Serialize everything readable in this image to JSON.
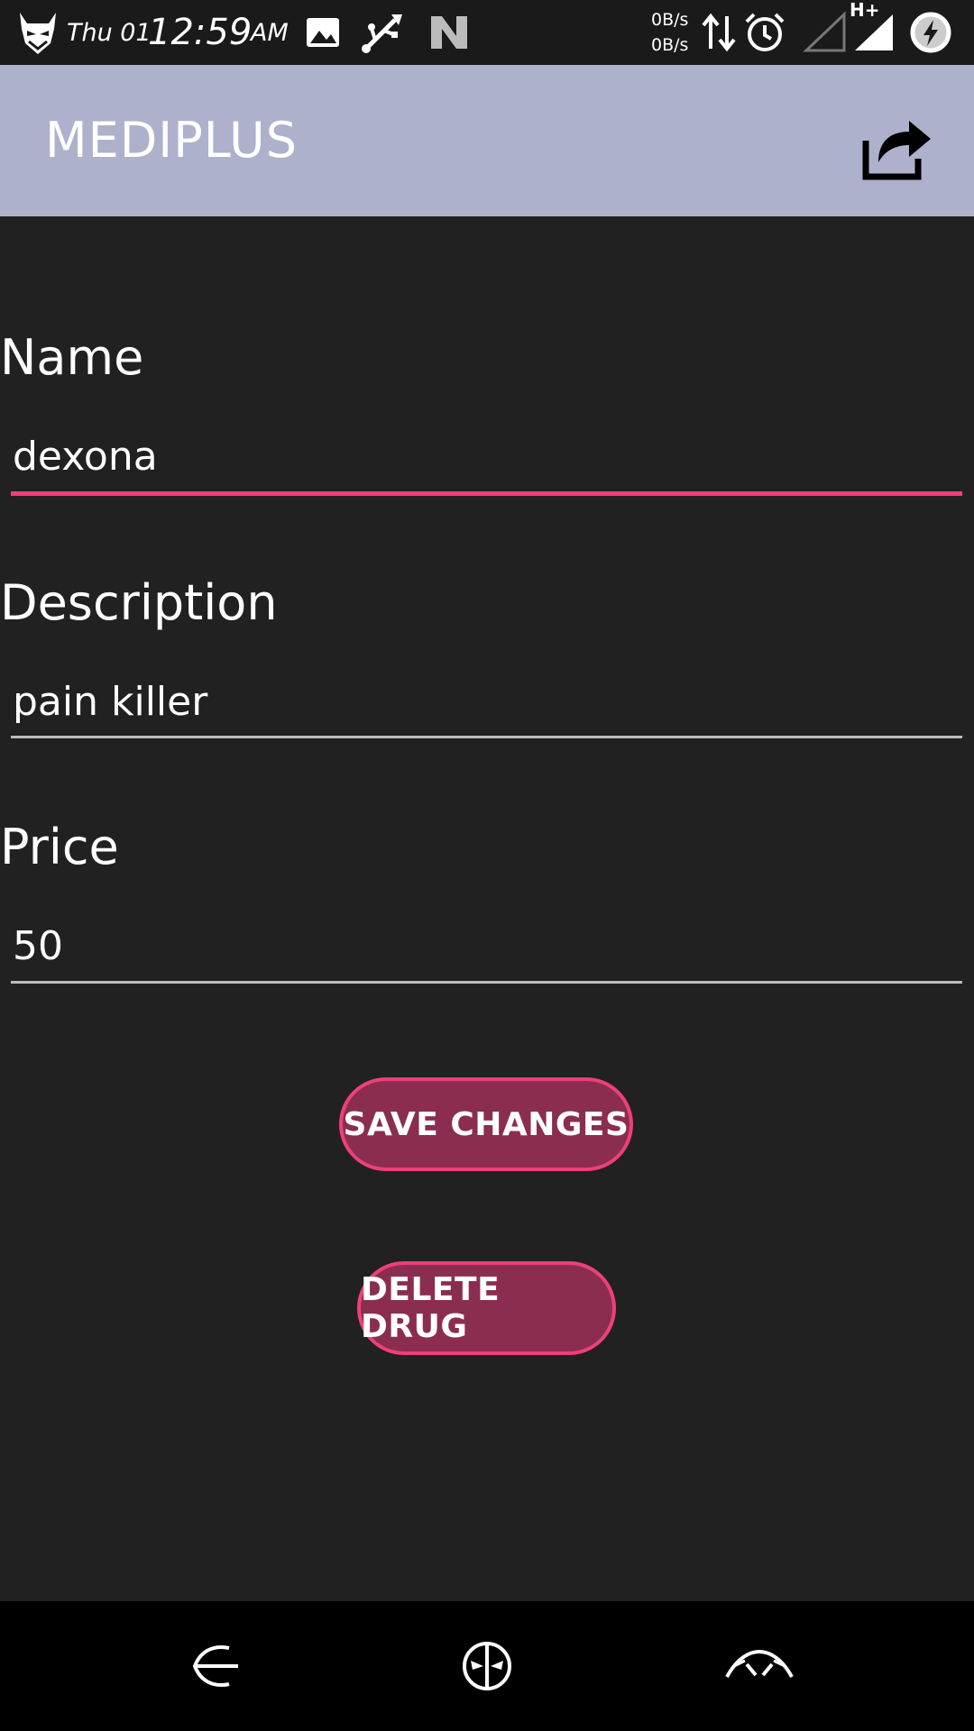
{
  "status_bar": {
    "day": "Thu 01",
    "time": "12:59",
    "ampm": "AM",
    "rate_up": "0B/s",
    "rate_down": "0B/s",
    "network": "H+",
    "icons": [
      "devil-logo-icon",
      "image-icon",
      "usb-icon",
      "n-icon",
      "data-arrows-icon",
      "alarm-icon",
      "signal-empty-icon",
      "signal-full-icon",
      "battery-charging-icon"
    ]
  },
  "app_bar": {
    "title": "MEDIPLUS",
    "share_icon": "share-icon",
    "background": "#aeb1cb"
  },
  "form": {
    "name": {
      "label": "Name",
      "value": "dexona"
    },
    "description": {
      "label": "Description",
      "value": "pain killer"
    },
    "price": {
      "label": "Price",
      "value": "50"
    }
  },
  "buttons": {
    "save_label": "SAVE CHANGES",
    "delete_label": "DELETE DRUG"
  },
  "colors": {
    "accent": "#ec407a",
    "button_fill": "#8b2d50",
    "background": "#212121"
  },
  "nav_bar": {
    "icons": [
      "back-icon",
      "home-icon",
      "recents-icon"
    ]
  }
}
